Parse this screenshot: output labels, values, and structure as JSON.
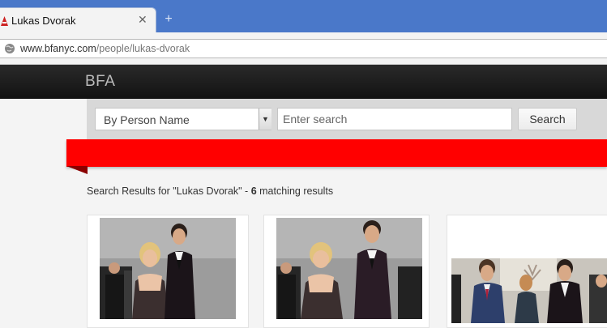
{
  "browser": {
    "tab_title": "Lukas Dvorak",
    "close_glyph": "✕",
    "newtab_glyph": "+",
    "url_domain": "www.bfanyc.com",
    "url_path": "/people/lukas-dvorak"
  },
  "site": {
    "logo": "BFA"
  },
  "search": {
    "select_value": "By Person Name",
    "placeholder": "Enter search",
    "button_label": "Search"
  },
  "results": {
    "prefix": "Search Results for \"Lukas Dvorak\" - ",
    "count": "6",
    "suffix": " matching results"
  },
  "colors": {
    "ribbon": "#ff0000",
    "header": "#1a1a1a",
    "tabstrip": "#4a78c9"
  },
  "icons": [
    "favicon-icon",
    "close-icon",
    "plus-icon",
    "globe-icon",
    "chevron-down-icon"
  ]
}
